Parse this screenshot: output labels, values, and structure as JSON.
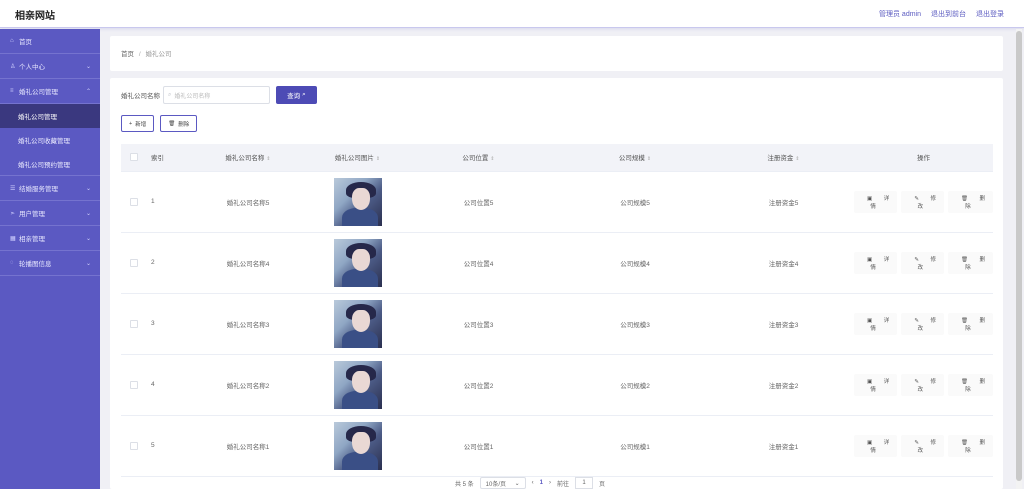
{
  "header": {
    "site_title": "相亲网站",
    "links": [
      "管理员 admin",
      "退出到前台",
      "退出登录"
    ]
  },
  "sidebar": {
    "items": [
      {
        "label": "首页",
        "icon": "home-icon"
      },
      {
        "label": "个人中心",
        "icon": "user-icon"
      },
      {
        "label": "婚礼公司管理",
        "icon": "menu-icon"
      },
      {
        "label": "婚礼公司管理",
        "sub": true,
        "active": true
      },
      {
        "label": "婚礼公司收藏管理",
        "sub": true
      },
      {
        "label": "婚礼公司预约管理",
        "sub": true
      },
      {
        "label": "结婚服务管理",
        "icon": "list-icon"
      },
      {
        "label": "用户管理",
        "icon": "send-icon"
      },
      {
        "label": "相亲管理",
        "icon": "grid-icon"
      },
      {
        "label": "轮播图信息",
        "icon": "chat-icon"
      }
    ]
  },
  "breadcrumb": {
    "home": "首页",
    "separator": "/",
    "current": "婚礼公司"
  },
  "search": {
    "label": "婚礼公司名称",
    "placeholder": "婚礼公司名称",
    "button": "查询"
  },
  "actions": {
    "add": "新增",
    "delete": "删除"
  },
  "table": {
    "headers": [
      "索引",
      "婚礼公司名称",
      "婚礼公司图片",
      "公司位置",
      "公司规模",
      "注册资金",
      "操作"
    ],
    "rows": [
      {
        "index": "1",
        "name": "婚礼公司名称5",
        "location": "公司位置5",
        "scale": "公司规模5",
        "capital": "注册资金5"
      },
      {
        "index": "2",
        "name": "婚礼公司名称4",
        "location": "公司位置4",
        "scale": "公司规模4",
        "capital": "注册资金4"
      },
      {
        "index": "3",
        "name": "婚礼公司名称3",
        "location": "公司位置3",
        "scale": "公司规模3",
        "capital": "注册资金3"
      },
      {
        "index": "4",
        "name": "婚礼公司名称2",
        "location": "公司位置2",
        "scale": "公司规模2",
        "capital": "注册资金2"
      },
      {
        "index": "5",
        "name": "婚礼公司名称1",
        "location": "公司位置1",
        "scale": "公司规模1",
        "capital": "注册资金1"
      }
    ],
    "row_actions": {
      "detail": "详情",
      "edit": "修改",
      "delete": "删除"
    }
  },
  "pagination": {
    "total": "共 5 条",
    "page_size": "10条/页",
    "current_page": "1",
    "goto_label": "前往",
    "goto_value": "1",
    "page_unit": "页"
  },
  "colors": {
    "sidebar": "#5b59c2",
    "accent": "#4d4bb5",
    "active_item": "#3a387f"
  }
}
